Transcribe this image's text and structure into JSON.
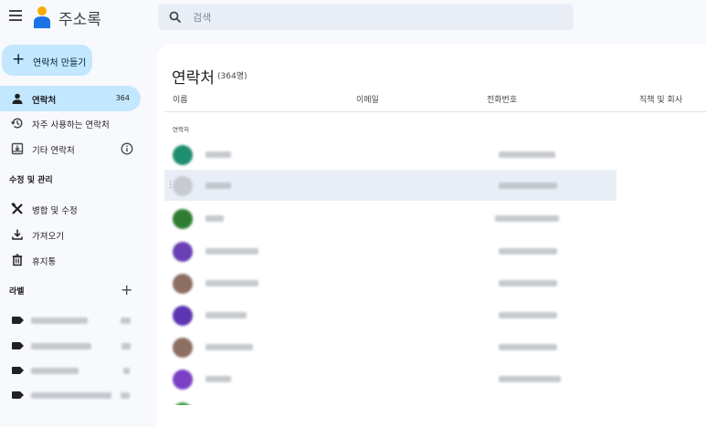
{
  "app": {
    "title": "주소록"
  },
  "search": {
    "placeholder": "검색"
  },
  "create": {
    "label": "연락처 만들기"
  },
  "nav": [
    {
      "label": "연락처",
      "count": "364",
      "active": true,
      "icon": "person-icon"
    },
    {
      "label": "자주 사용하는 연락처",
      "icon": "history-icon"
    },
    {
      "label": "기타 연락처",
      "icon": "inbox-arrow-icon"
    }
  ],
  "manage": {
    "title": "수정 및 관리",
    "items": [
      {
        "label": "병합 및 수정",
        "icon": "merge-tools-icon"
      },
      {
        "label": "가져오기",
        "icon": "download-icon"
      },
      {
        "label": "휴지통",
        "icon": "trash-icon"
      }
    ]
  },
  "labels_section": {
    "title": "라벨"
  },
  "labels": [
    {
      "icon": "label-icon"
    },
    {
      "icon": "label-icon"
    },
    {
      "icon": "label-icon"
    },
    {
      "icon": "label-icon"
    }
  ],
  "main": {
    "title": "연락처",
    "count": "(364명)",
    "columns": {
      "name": "이름",
      "email": "이메일",
      "phone": "전화번호",
      "job": "직책 및 회사"
    },
    "group_label": "연락처"
  },
  "contacts": [
    {
      "avatar_color": "#1e8e6e"
    },
    {
      "avatar_color": "#c7cbd1",
      "hover": true
    },
    {
      "avatar_color": "#2e7d32"
    },
    {
      "avatar_color": "#6a3fb5"
    },
    {
      "avatar_color": "#8d6e63"
    },
    {
      "avatar_color": "#5e35b1"
    },
    {
      "avatar_color": "#8d6e63"
    },
    {
      "avatar_color": "#7b3fc4"
    }
  ],
  "colors": {
    "accent": "#c2e7ff",
    "search_bg": "#e9eef6",
    "background": "#f8f9fc"
  }
}
